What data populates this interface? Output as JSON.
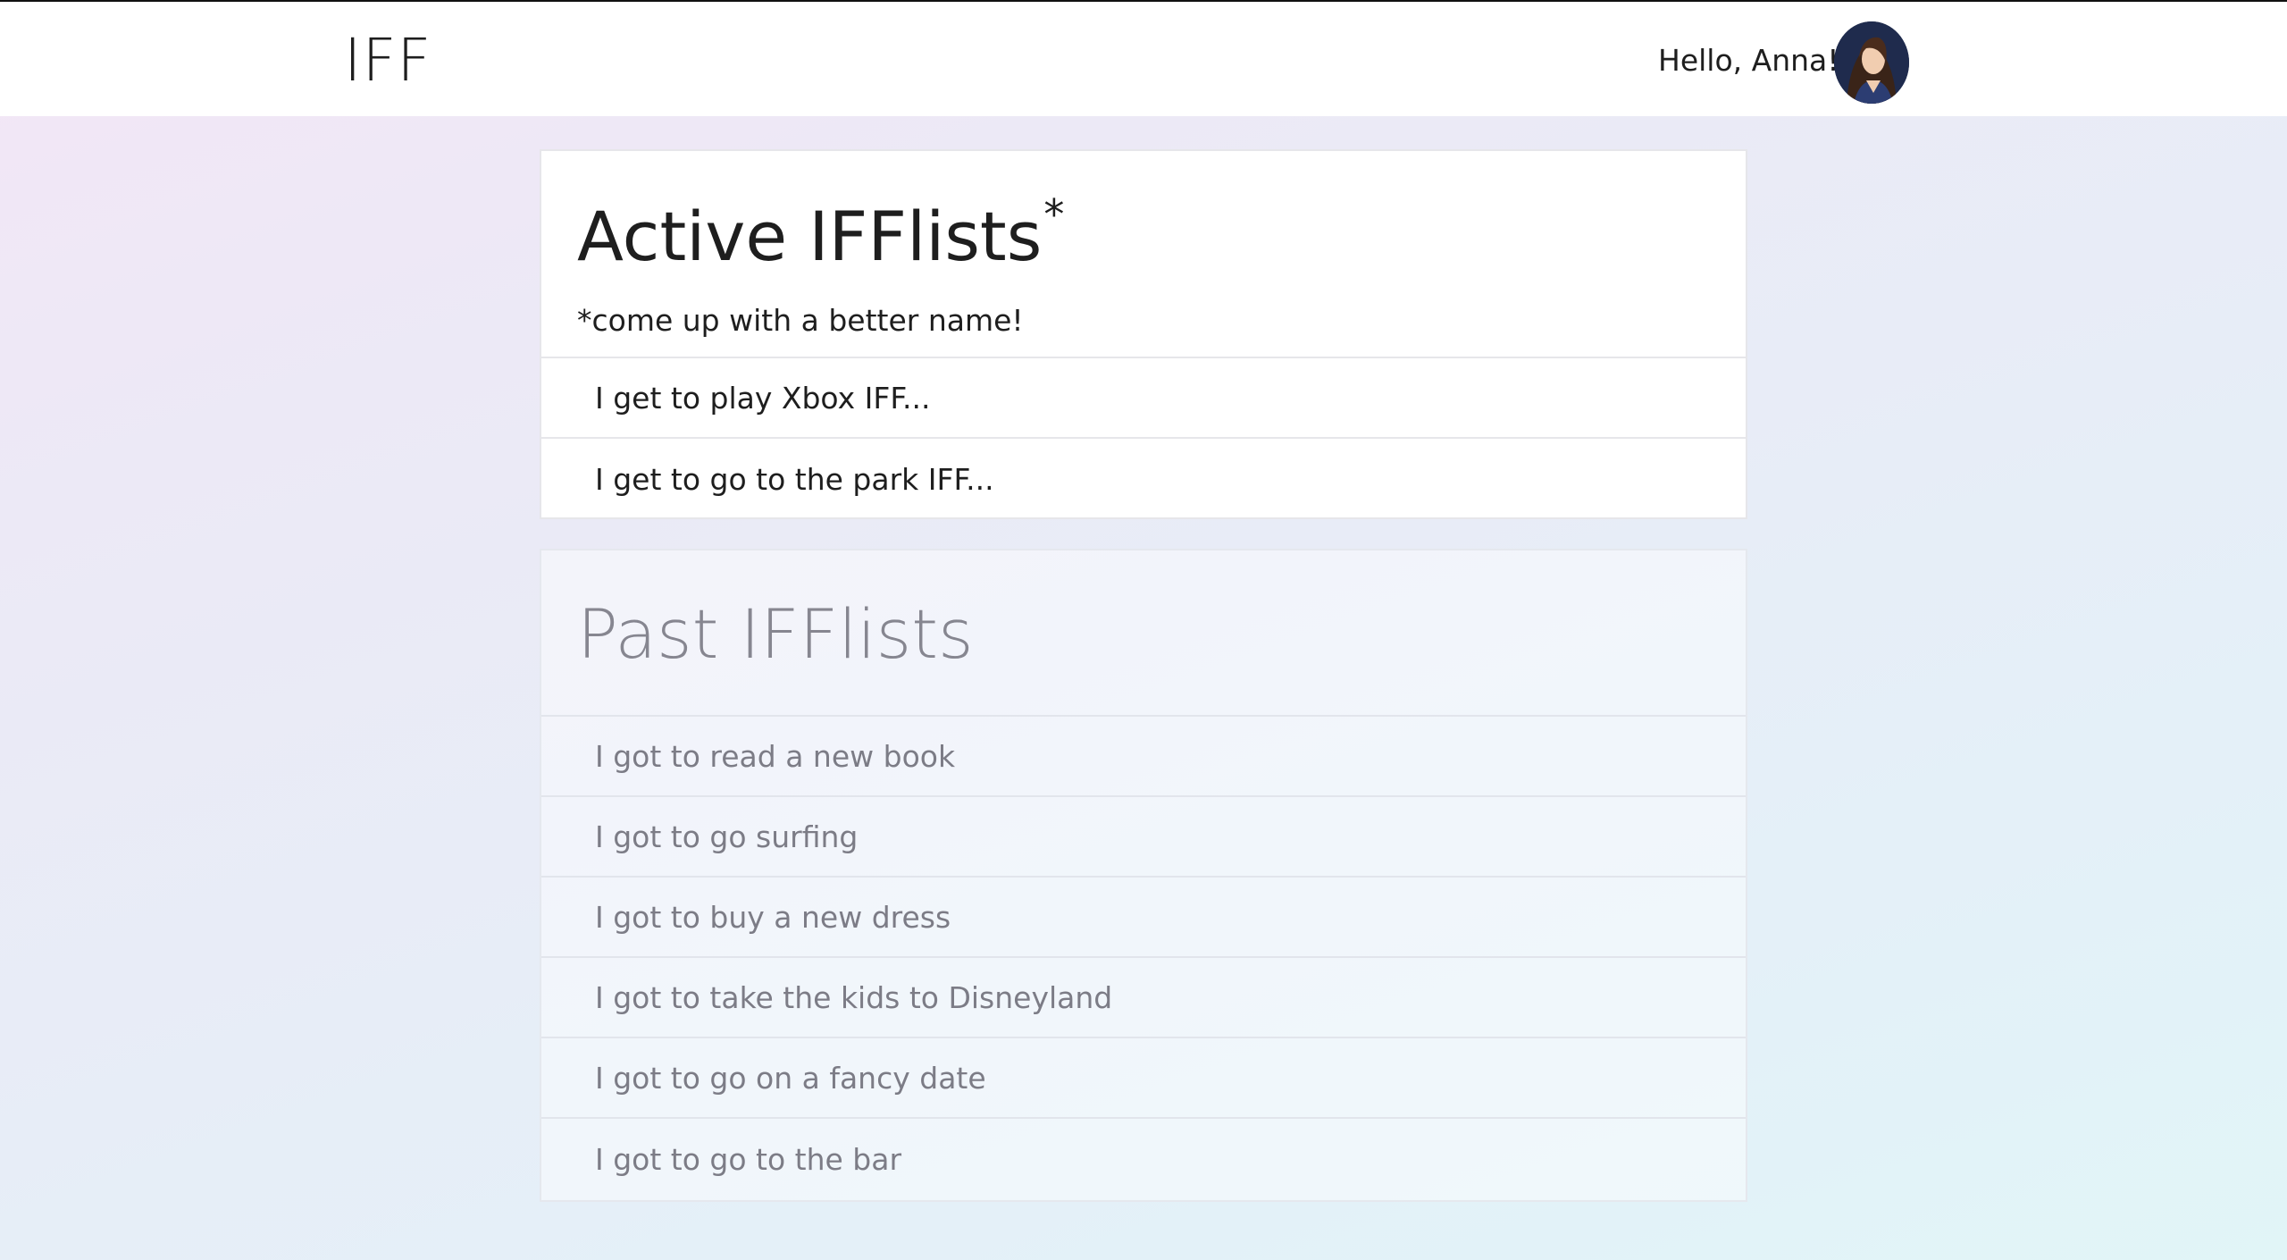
{
  "header": {
    "brand": "IFF",
    "greeting": "Hello, Anna!",
    "avatar_alt": "Anna"
  },
  "active": {
    "title": "Active IFFlists",
    "title_mark": "*",
    "note": "*come up with a better name!",
    "items": [
      "I get to play Xbox IFF...",
      "I get to go to the park IFF..."
    ]
  },
  "past": {
    "title": "Past IFFlists",
    "items": [
      "I got to read a new book",
      "I got to go surfing",
      "I got to buy a new dress",
      "I got to take the kids to Disneyland",
      "I got to go on a fancy date",
      "I got to go to the bar"
    ]
  }
}
